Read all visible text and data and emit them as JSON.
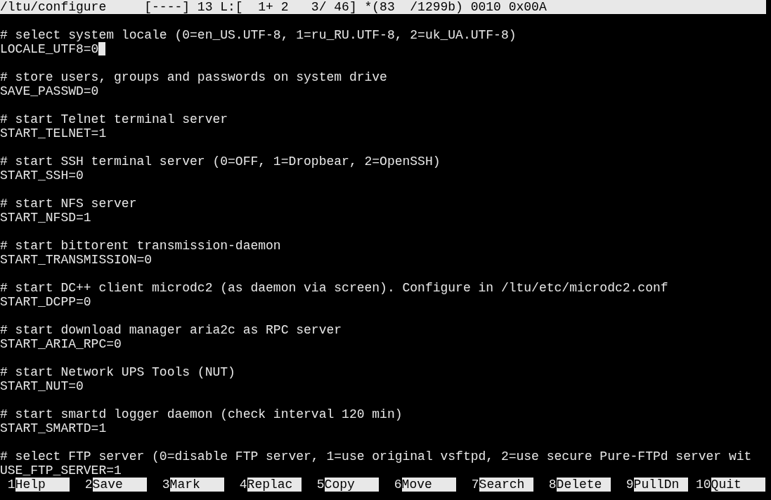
{
  "status_bar": {
    "file": "/ltu/configure",
    "info": "[----] 13 L:[  1+ 2   3/ 46] *(83  /1299b) 0010 0x00A"
  },
  "groups": [
    {
      "comment": "# select system locale (0=en_US.UTF-8, 1=ru_RU.UTF-8, 2=uk_UA.UTF-8)",
      "setting": "LOCALE_UTF8=0",
      "cursor": true
    },
    {
      "comment": "# store users, groups and passwords on system drive",
      "setting": "SAVE_PASSWD=0",
      "cursor": false
    },
    {
      "comment": "# start Telnet terminal server",
      "setting": "START_TELNET=1",
      "cursor": false
    },
    {
      "comment": "# start SSH terminal server (0=OFF, 1=Dropbear, 2=OpenSSH)",
      "setting": "START_SSH=0",
      "cursor": false
    },
    {
      "comment": "# start NFS server",
      "setting": "START_NFSD=1",
      "cursor": false
    },
    {
      "comment": "# start bittorent transmission-daemon",
      "setting": "START_TRANSMISSION=0",
      "cursor": false
    },
    {
      "comment": "# start DC++ client microdc2 (as daemon via screen). Configure in /ltu/etc/microdc2.conf",
      "setting": "START_DCPP=0",
      "cursor": false
    },
    {
      "comment": "# start download manager aria2c as RPC server",
      "setting": "START_ARIA_RPC=0",
      "cursor": false
    },
    {
      "comment": "# start Network UPS Tools (NUT)",
      "setting": "START_NUT=0",
      "cursor": false
    },
    {
      "comment": "# start smartd logger daemon (check interval 120 min)",
      "setting": "START_SMARTD=1",
      "cursor": false
    },
    {
      "comment": "# select FTP server (0=disable FTP server, 1=use original vsftpd, 2=use secure Pure-FTPd server wit",
      "setting": "USE_FTP_SERVER=1",
      "cursor": false
    }
  ],
  "function_keys": [
    {
      "number": "1",
      "label": "Help"
    },
    {
      "number": "2",
      "label": "Save"
    },
    {
      "number": "3",
      "label": "Mark"
    },
    {
      "number": "4",
      "label": "Replac"
    },
    {
      "number": "5",
      "label": "Copy"
    },
    {
      "number": "6",
      "label": "Move"
    },
    {
      "number": "7",
      "label": "Search"
    },
    {
      "number": "8",
      "label": "Delete"
    },
    {
      "number": "9",
      "label": "PullDn"
    },
    {
      "number": "10",
      "label": "Quit"
    }
  ]
}
